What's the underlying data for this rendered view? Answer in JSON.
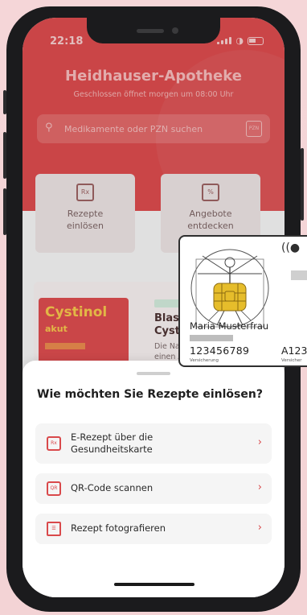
{
  "status_bar": {
    "time": "22:18"
  },
  "pharmacy": {
    "name": "Heidhauser-Apotheke",
    "hours_note": "Geschlossen öffnet morgen um 08:00 Uhr"
  },
  "search": {
    "placeholder": "Medikamente oder PZN suchen",
    "scan_label": "PZN"
  },
  "tiles": [
    {
      "label_line1": "Rezepte",
      "label_line2": "einlösen",
      "icon": "prescription-icon"
    },
    {
      "label_line1": "Angebote",
      "label_line2": "entdecken",
      "icon": "discount-icon"
    }
  ],
  "promo": {
    "product": "Cystinol",
    "product_sub": "akut",
    "title_line1": "Blase",
    "title_line2": "Cysti",
    "desc_line1": "Die Nat",
    "desc_line2": "einen A"
  },
  "sheet": {
    "title": "Wie möchten Sie Rezepte einlösen?",
    "options": [
      {
        "label_line1": "E-Rezept über die",
        "label_line2": "Gesundheitskarte",
        "icon": "health-card-icon"
      },
      {
        "label": "QR-Code scannen",
        "icon": "qr-code-icon"
      },
      {
        "label": "Rezept fotografieren",
        "icon": "photo-prescription-icon"
      }
    ]
  },
  "health_card": {
    "holder_name": "Maria Musterfrau",
    "insurance_number": "123456789",
    "insurance_label": "Versicherung",
    "second_number": "A123",
    "second_label": "Versicher"
  },
  "colors": {
    "brand_red": "#d9494b",
    "chevron": "#d9494b"
  }
}
